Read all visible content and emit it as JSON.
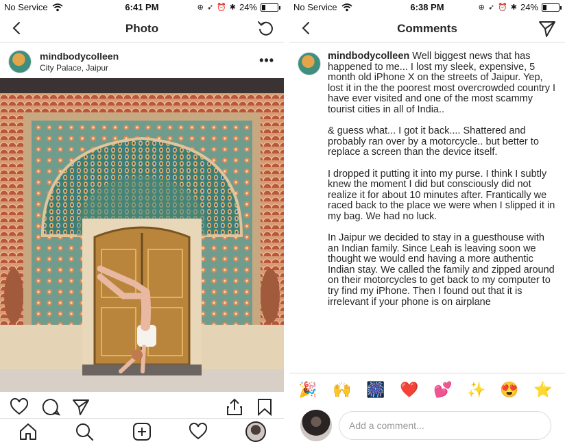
{
  "left": {
    "status": {
      "carrier": "No Service",
      "time": "6:41 PM",
      "battery": "24%",
      "battery_level": 0.24
    },
    "nav": {
      "title": "Photo"
    },
    "post": {
      "username": "mindbodycolleen",
      "location": "City Palace, Jaipur",
      "more": "•••"
    }
  },
  "right": {
    "status": {
      "carrier": "No Service",
      "time": "6:38 PM",
      "battery": "24%",
      "battery_level": 0.24
    },
    "nav": {
      "title": "Comments"
    },
    "caption": {
      "username": "mindbodycolleen",
      "paragraphs": [
        "Well biggest news that has happened to me... I lost my sleek, expensive, 5 month old iPhone X on the streets of Jaipur. Yep, lost it in the the poorest most overcrowded country I have ever visited and one of the most scammy tourist cities in all of India..",
        "& guess what... I got it back.... Shattered and probably ran over by a motorcycle.. but better to replace a screen than the device itself.",
        "I dropped it putting it into my purse. I think I subtly knew the moment I did but consciously did not realize it for about 10 minutes after. Frantically we raced back to the place we were when I slipped it in my bag. We had no luck.",
        "In Jaipur we decided to stay in a guesthouse with an Indian family. Since Leah is leaving soon we thought we would end having a more authentic Indian stay. We called the family and zipped around on their motorcycles to get back to my computer to try find my iPhone. Then I found out that it is irrelevant if your phone is on airplane"
      ]
    },
    "emoji_bar": [
      "🎉",
      "🙌",
      "🎆",
      "❤️",
      "💕",
      "✨",
      "😍",
      "⭐"
    ],
    "composer": {
      "placeholder": "Add a comment..."
    }
  }
}
